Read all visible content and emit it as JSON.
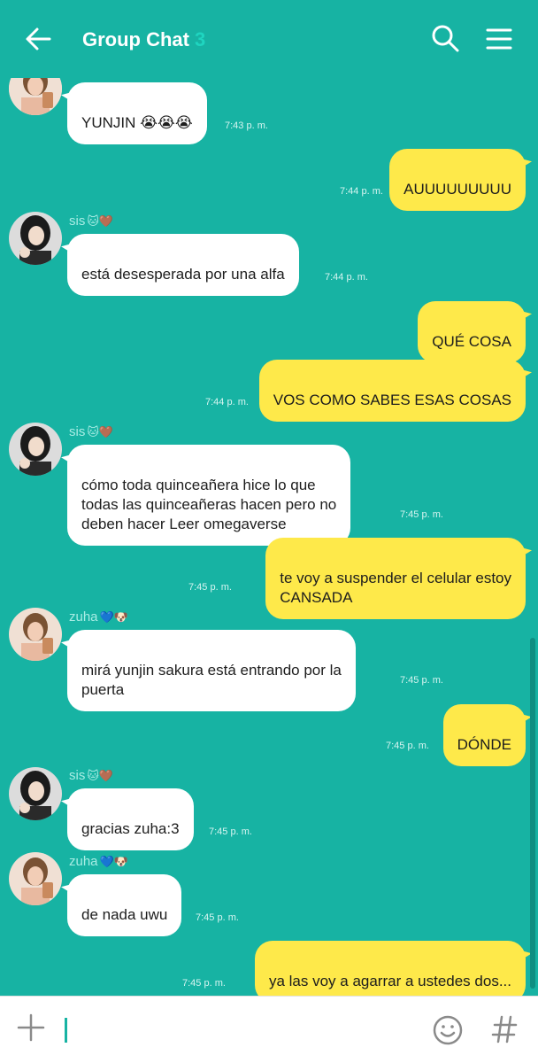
{
  "header": {
    "title": "Group Chat",
    "member_count": "3",
    "icons": [
      "back-arrow-icon",
      "search-icon",
      "menu-icon"
    ]
  },
  "messages": [
    {
      "direction": "in",
      "sender": "",
      "sender_emoji": "",
      "text": "YUNJIN 😭😭😭",
      "time": "7:43 p. m."
    },
    {
      "direction": "out",
      "text": "AUUUUUUUUU",
      "time": "7:44 p. m."
    },
    {
      "direction": "in",
      "sender": "sis",
      "sender_emoji": "🐱🤎",
      "text": "está desesperada por una alfa",
      "time": "7:44 p. m."
    },
    {
      "direction": "out",
      "text": "QUÉ COSA",
      "time": ""
    },
    {
      "direction": "out",
      "text": "VOS COMO SABES ESAS COSAS",
      "time": "7:44 p. m."
    },
    {
      "direction": "in",
      "sender": "sis",
      "sender_emoji": "🐱🤎",
      "text": "cómo toda quinceañera hice lo que\ntodas las quinceañeras hacen pero no\ndeben hacer Leer omegaverse",
      "time": "7:45 p. m."
    },
    {
      "direction": "out",
      "text": "te voy a suspender el celular estoy\nCANSADA",
      "time": "7:45 p. m."
    },
    {
      "direction": "in",
      "sender": "zuha",
      "sender_emoji": "💙🐶",
      "text": "mirá yunjin sakura está entrando por la\npuerta",
      "time": "7:45 p. m."
    },
    {
      "direction": "out",
      "text": "DÓNDE",
      "time": "7:45 p. m."
    },
    {
      "direction": "in",
      "sender": "sis",
      "sender_emoji": "🐱🤎",
      "text": "gracias zuha:3",
      "time": "7:45 p. m."
    },
    {
      "direction": "in",
      "sender": "zuha",
      "sender_emoji": "💙🐶",
      "text": "de nada uwu",
      "time": "7:45 p. m."
    },
    {
      "direction": "out",
      "text": "ya las voy a agarrar a ustedes dos...",
      "time": "7:45 p. m."
    }
  ],
  "input": {
    "value": "",
    "icons": [
      "plus-icon",
      "emoji-icon",
      "hashtag-icon"
    ]
  },
  "colors": {
    "background": "#17b3a3",
    "incoming_bubble": "#ffffff",
    "outgoing_bubble": "#fee94a"
  }
}
